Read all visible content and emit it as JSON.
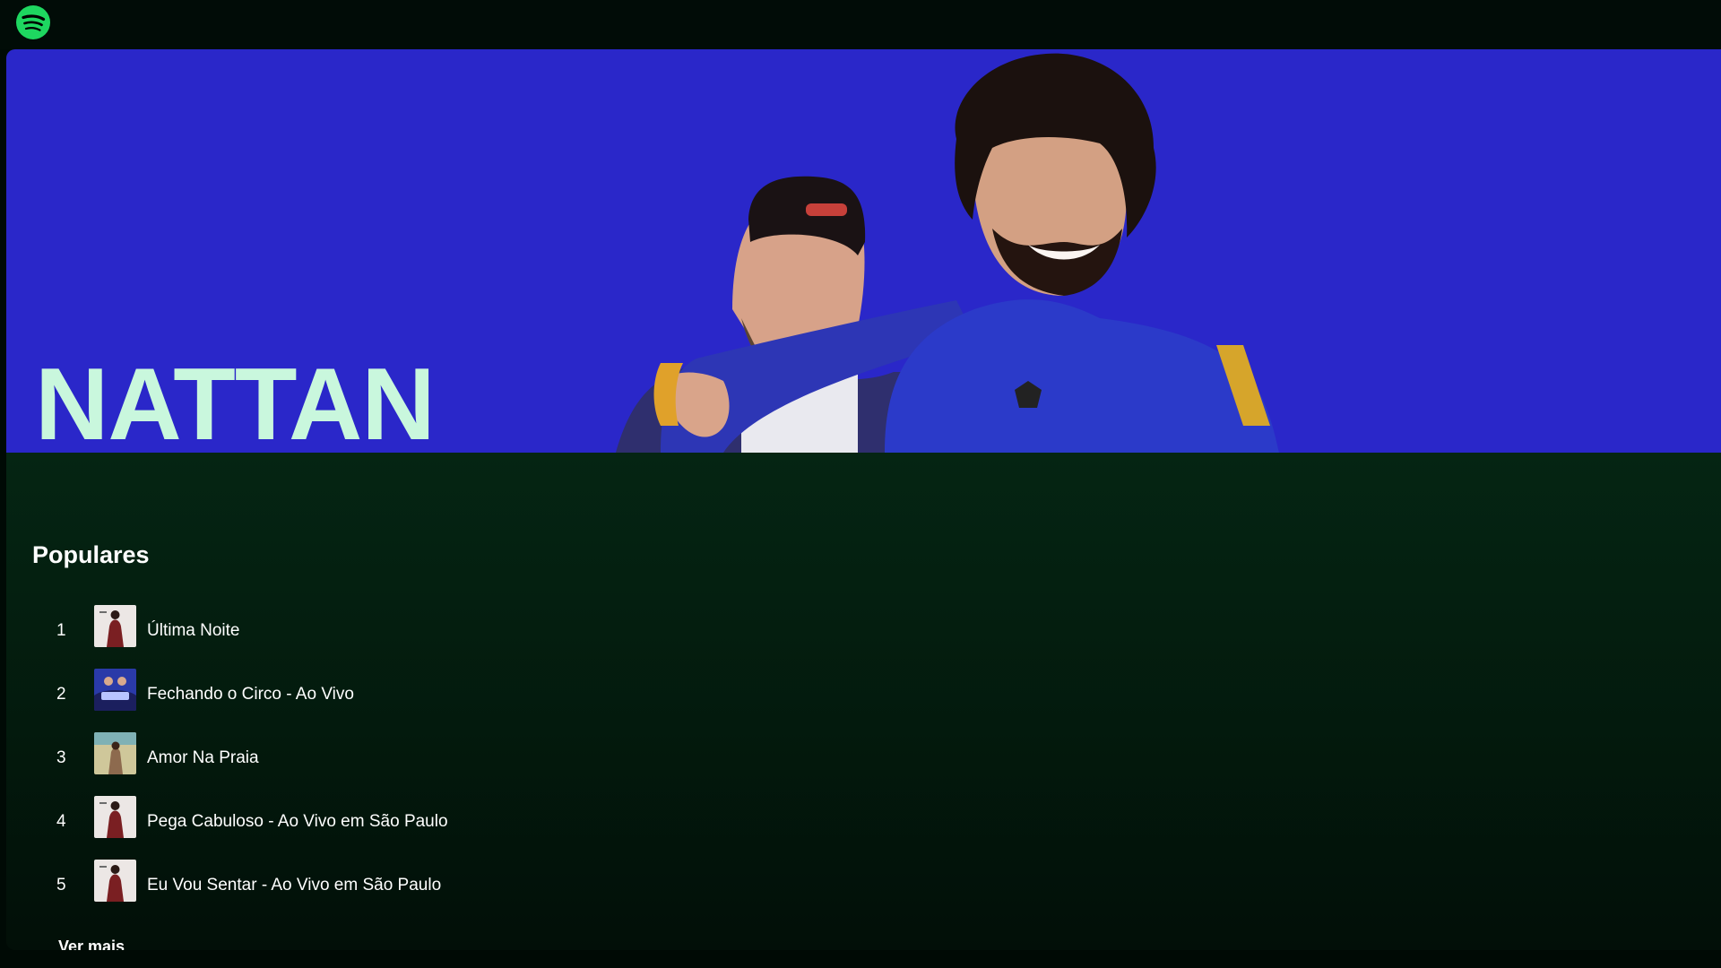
{
  "app": {
    "logo_icon": "spotify-logo-icon",
    "brand_color": "#1ed760"
  },
  "artist": {
    "name": "NATTAN",
    "hero_bg_color": "#2a27c9",
    "name_color": "#c9f7dd"
  },
  "popular": {
    "title": "Populares",
    "tracks": [
      {
        "rank": "1",
        "title": "Última Noite"
      },
      {
        "rank": "2",
        "title": "Fechando o Circo - Ao Vivo"
      },
      {
        "rank": "3",
        "title": "Amor Na Praia"
      },
      {
        "rank": "4",
        "title": "Pega Cabuloso - Ao Vivo em São Paulo"
      },
      {
        "rank": "5",
        "title": "Eu Vou Sentar - Ao Vivo em São Paulo"
      }
    ],
    "see_more": "Ver mais"
  }
}
